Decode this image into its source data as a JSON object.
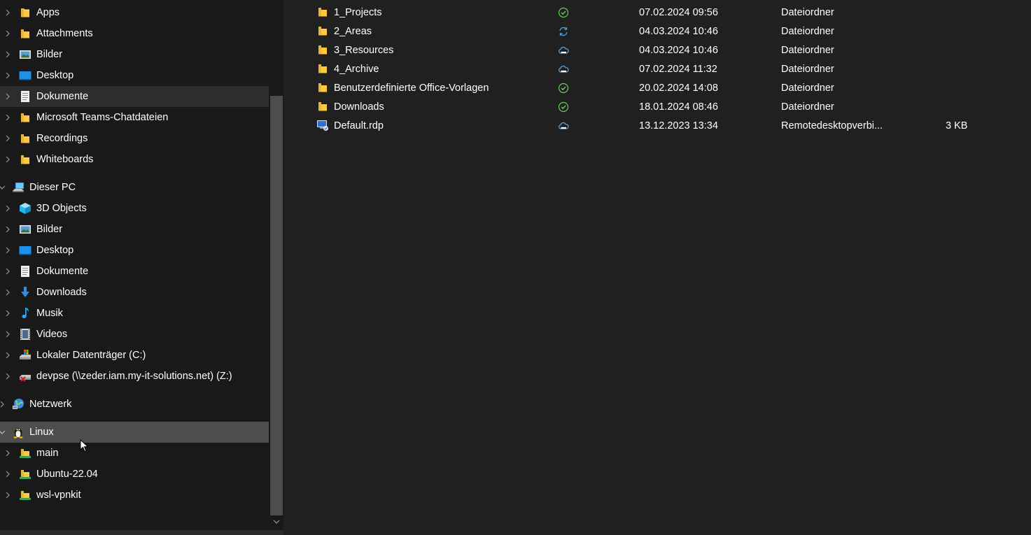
{
  "navigation": {
    "items": [
      {
        "label": "Apps",
        "icon": "folder-icon"
      },
      {
        "label": "Attachments",
        "icon": "folder-icon"
      },
      {
        "label": "Bilder",
        "icon": "pictures-icon"
      },
      {
        "label": "Desktop",
        "icon": "desktop-icon"
      },
      {
        "label": "Dokumente",
        "icon": "documents-icon"
      },
      {
        "label": "Microsoft Teams-Chatdateien",
        "icon": "folder-icon"
      },
      {
        "label": "Recordings",
        "icon": "folder-icon"
      },
      {
        "label": "Whiteboards",
        "icon": "folder-icon"
      },
      {
        "label": "Dieser PC",
        "icon": "this-pc-icon"
      },
      {
        "label": "3D Objects",
        "icon": "3d-objects-icon"
      },
      {
        "label": "Bilder",
        "icon": "pictures-icon"
      },
      {
        "label": "Desktop",
        "icon": "desktop-icon"
      },
      {
        "label": "Dokumente",
        "icon": "documents-icon"
      },
      {
        "label": "Downloads",
        "icon": "downloads-icon"
      },
      {
        "label": "Musik",
        "icon": "music-icon"
      },
      {
        "label": "Videos",
        "icon": "videos-icon"
      },
      {
        "label": "Lokaler Datenträger (C:)",
        "icon": "local-disk-icon"
      },
      {
        "label": "devpse (\\\\zeder.iam.my-it-solutions.net) (Z:)",
        "icon": "network-drive-icon"
      },
      {
        "label": "Netzwerk",
        "icon": "network-icon"
      },
      {
        "label": "Linux",
        "icon": "linux-tux-icon"
      },
      {
        "label": "main",
        "icon": "linux-folder-icon"
      },
      {
        "label": "Ubuntu-22.04",
        "icon": "linux-folder-icon"
      },
      {
        "label": "wsl-vpnkit",
        "icon": "linux-folder-icon"
      }
    ]
  },
  "files": [
    {
      "name": "1_Projects",
      "icon": "folder-icon",
      "status": "synced-check-icon",
      "date": "07.02.2024 09:56",
      "type": "Dateiordner",
      "size": ""
    },
    {
      "name": "2_Areas",
      "icon": "folder-icon",
      "status": "sync-pending-icon",
      "date": "04.03.2024 10:46",
      "type": "Dateiordner",
      "size": ""
    },
    {
      "name": "3_Resources",
      "icon": "folder-icon",
      "status": "cloud-only-icon",
      "date": "04.03.2024 10:46",
      "type": "Dateiordner",
      "size": ""
    },
    {
      "name": "4_Archive",
      "icon": "folder-icon",
      "status": "cloud-only-icon",
      "date": "07.02.2024 11:32",
      "type": "Dateiordner",
      "size": ""
    },
    {
      "name": "Benutzerdefinierte Office-Vorlagen",
      "icon": "folder-icon",
      "status": "synced-check-icon",
      "date": "20.02.2024 14:08",
      "type": "Dateiordner",
      "size": ""
    },
    {
      "name": "Downloads",
      "icon": "folder-icon",
      "status": "synced-check-icon",
      "date": "18.01.2024 08:46",
      "type": "Dateiordner",
      "size": ""
    },
    {
      "name": "Default.rdp",
      "icon": "rdp-file-icon",
      "status": "cloud-only-icon",
      "date": "13.12.2023 13:34",
      "type": "Remotedesktopverbi...",
      "size": "3 KB"
    }
  ],
  "colors": {
    "background_nav": "#191919",
    "background_content": "#202020",
    "selected_row": "#4d4d4d",
    "hover_row": "#2d2d2d",
    "folder_yellow": "#f8d775",
    "sync_green": "#6ccb5f",
    "cloud_blue": "#4fa3e0"
  }
}
